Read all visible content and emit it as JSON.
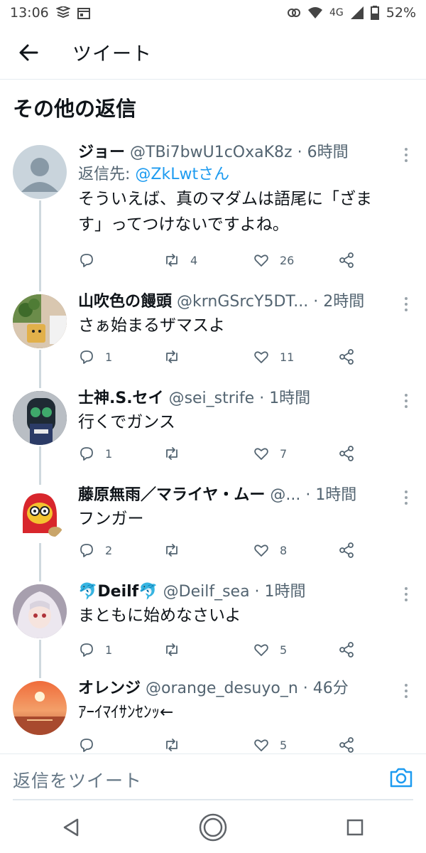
{
  "status_bar": {
    "time": "13:06",
    "network": "4G",
    "battery": "52%"
  },
  "header": {
    "title": "ツイート"
  },
  "section": {
    "title": "その他の返信"
  },
  "replies": [
    {
      "name": "ジョー",
      "handle": "@TBi7bwU1cOxaK8z",
      "time": "6時間",
      "reply_to_prefix": "返信先: ",
      "reply_to_handle": "@ZkLwtさん",
      "text_line1": "そういえば、真のマダムは語尾に「ざま",
      "text_line2": "す」ってつけないですよね。",
      "replies_count": "",
      "retweets": "4",
      "likes": "26"
    },
    {
      "name": "山吹色の饅頭",
      "handle": "@krnGSrcY5DT...",
      "time": "2時間",
      "text_line1": "さぁ始まるザマスよ",
      "replies_count": "1",
      "retweets": "",
      "likes": "11"
    },
    {
      "name": "士神.S.セイ",
      "handle": "@sei_strife",
      "time": "1時間",
      "text_line1": "行くでガンス",
      "replies_count": "1",
      "retweets": "",
      "likes": "7"
    },
    {
      "name": "藤原無雨／マライヤ・ムー",
      "handle": "@...",
      "time": "1時間",
      "text_line1": "フンガー",
      "replies_count": "2",
      "retweets": "",
      "likes": "8"
    },
    {
      "name": "🐬Deilf🐬",
      "handle": "@Deilf_sea",
      "time": "1時間",
      "text_line1": "まともに始めなさいよ",
      "replies_count": "1",
      "retweets": "",
      "likes": "5"
    },
    {
      "name": "オレンジ",
      "handle": "@orange_desuyo_n",
      "time": "46分",
      "text_line1": "ｱｰｲﾏｲｻﾝｾﾝｯ←",
      "replies_count": "",
      "retweets": "",
      "likes": "5"
    }
  ],
  "composer": {
    "placeholder": "返信をツイート"
  },
  "colors": {
    "link": "#1d9bf0",
    "meta_text": "#536471",
    "thread_line": "#cfd9de"
  },
  "icons": [
    "back-arrow-icon",
    "reply-icon",
    "retweet-icon",
    "like-icon",
    "share-icon",
    "more-icon",
    "camera-icon",
    "nav-back-icon",
    "nav-home-icon",
    "nav-recents-icon"
  ]
}
